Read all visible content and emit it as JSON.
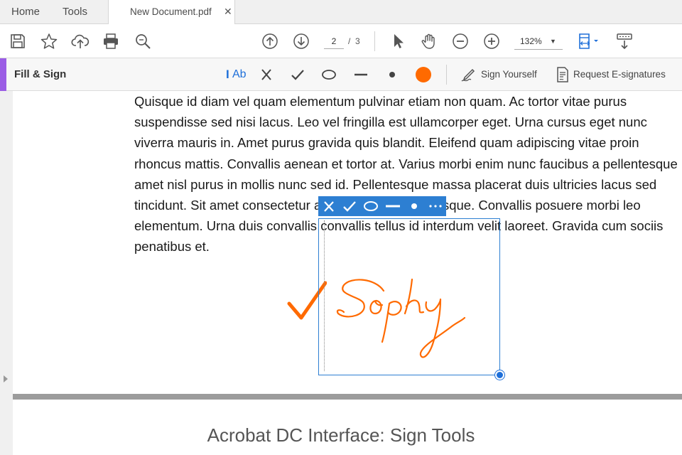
{
  "tabs": {
    "home": "Home",
    "tools": "Tools",
    "document": "New Document.pdf",
    "close": "✕"
  },
  "toolbar": {
    "current_page": "2",
    "page_separator": "/",
    "total_pages": "3",
    "zoom": "132%",
    "icons": [
      "save-icon",
      "star-icon",
      "upload-icon",
      "print-icon",
      "search-icon",
      "page-up-icon",
      "page-down-icon",
      "select-cursor-icon",
      "hand-icon",
      "zoom-out-icon",
      "zoom-in-icon",
      "fit-page-icon",
      "download-tray-icon"
    ]
  },
  "fill_sign": {
    "title": "Fill & Sign",
    "add_text_label": "Ab",
    "sign_yourself": "Sign Yourself",
    "request_signatures": "Request E-signatures",
    "accent_color": "#9b5de5",
    "active_color": "#ff6a00",
    "tools": [
      "text-tool-icon",
      "cross-icon",
      "check-icon",
      "ellipse-icon",
      "line-icon",
      "dot-icon",
      "color-swatch-icon"
    ]
  },
  "document": {
    "lines": [
      "Quisque id diam vel quam elementum pulvinar etiam non quam. Ac tortor vitae purus",
      "suspendisse sed nisi lacus. Leo vel fringilla est ullamcorper eget. Urna cursus eget nunc",
      "viverra mauris in. Amet purus gravida quis blandit. Eleifend quam adipiscing vitae proin",
      "rhoncus mattis. Convallis aenean et tortor at. Varius morbi enim nunc faucibus a pellentesque",
      "amet nisl purus in mollis nunc sed id. Pellentesque massa placerat duis ultricies lacus sed",
      "tincidunt. Sit amet consectetur adipiscing elit pellentesque. Convallis posuere morbi leo",
      "elementum. Urna duis convallis convallis tellus id interdum velit laoreet. Gravida cum sociis",
      "penatibus et."
    ],
    "signature_name": "Sophy",
    "signature_color": "#ff6a00",
    "caption": "Acrobat DC Interface: Sign Tools"
  },
  "mini_toolbar": {
    "icons": [
      "cross-icon",
      "check-icon",
      "ellipse-icon",
      "line-icon",
      "dot-icon",
      "more-icon"
    ],
    "color": "#2d7fd2"
  }
}
